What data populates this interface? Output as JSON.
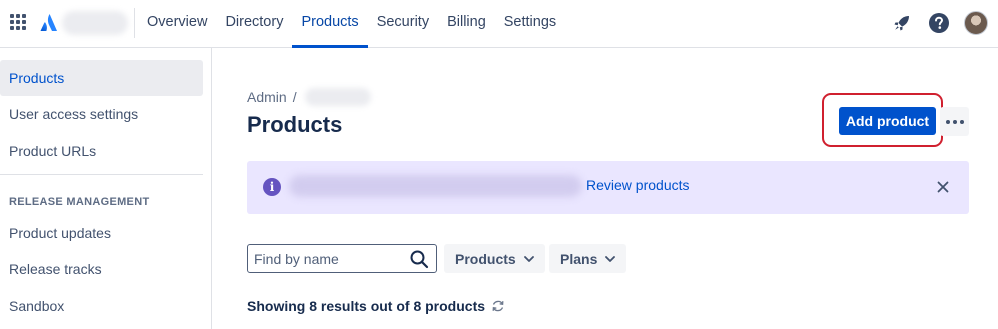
{
  "topnav": {
    "tabs": [
      {
        "label": "Overview"
      },
      {
        "label": "Directory"
      },
      {
        "label": "Products",
        "active": true
      },
      {
        "label": "Security"
      },
      {
        "label": "Billing"
      },
      {
        "label": "Settings"
      }
    ],
    "right_icons": [
      "rocket-icon",
      "help-icon",
      "user-avatar"
    ]
  },
  "sidebar": {
    "items": [
      {
        "label": "Products",
        "active": true
      },
      {
        "label": "User access settings"
      },
      {
        "label": "Product URLs"
      }
    ],
    "section_heading": "RELEASE MANAGEMENT",
    "section_items": [
      {
        "label": "Product updates"
      },
      {
        "label": "Release tracks"
      },
      {
        "label": "Sandbox"
      }
    ]
  },
  "main": {
    "breadcrumb": {
      "root": "Admin",
      "separator": "/"
    },
    "title": "Products",
    "add_button": "Add product",
    "banner": {
      "link": "Review products"
    },
    "search": {
      "placeholder": "Find by name",
      "value": ""
    },
    "filters": [
      {
        "label": "Products"
      },
      {
        "label": "Plans"
      }
    ],
    "results_text": "Showing 8 results out of 8 products"
  },
  "colors": {
    "primary": "#0052CC",
    "banner_bg": "#EAE6FF",
    "info": "#6554C0",
    "highlight_ring": "#D0202F"
  }
}
